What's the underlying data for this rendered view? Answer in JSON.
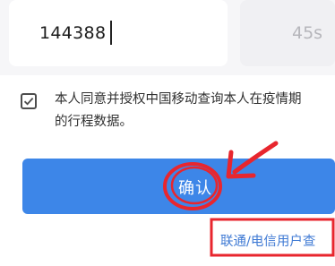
{
  "verification": {
    "code_value": "144388",
    "countdown": "45s"
  },
  "consent": {
    "line1": "本人同意并授权中国移动查询本人在疫情期",
    "line2": "的行程数据。"
  },
  "actions": {
    "confirm_label": "确认",
    "alt_carrier_link": "联通/电信用户查"
  },
  "colors": {
    "primary": "#3d86e8",
    "link": "#3f7ad4",
    "annotation": "#e8262e"
  }
}
